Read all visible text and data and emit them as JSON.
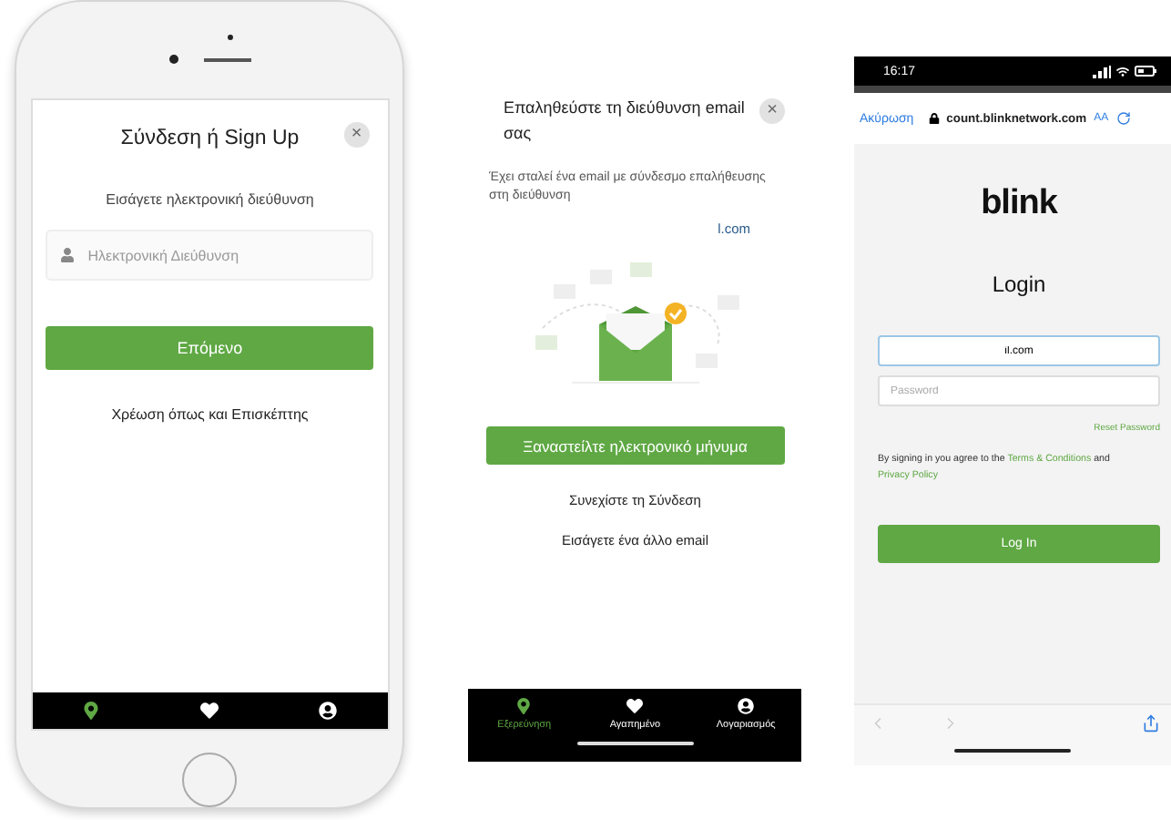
{
  "signup_screen": {
    "title": "Σύνδεση ή Sign Up",
    "close": "×",
    "prompt": "Εισάγετε ηλεκτρονική διεύθυνση",
    "email_field": {
      "placeholder": "Ηλεκτρονική Διεύθυνση"
    },
    "next_button": "Επόμενο",
    "guest_link": "Χρέωση όπως και Επισκέπτης",
    "nav_items": [
      {
        "selected": true
      },
      {
        "selected": false
      },
      {
        "selected": false
      }
    ]
  },
  "verify_screen": {
    "title": "Επαληθεύστε τη διεύθυνση email σας",
    "close": "×",
    "message": "Έχει σταλεί ένα email με σύνδεσμο επαλήθευσης στη διεύθυνση",
    "email": "l.com",
    "resend_button": "Ξαναστείλτε ηλεκτρονικό μήνυμα",
    "continue_link": "Συνεχίστε τη Σύνδεση",
    "other_email_link": "Εισάγετε ένα άλλο email",
    "nav_items": [
      {
        "label": "Εξερεύνηση",
        "selected": true
      },
      {
        "label": "Αγαπημένο",
        "selected": false
      },
      {
        "label": "Λογαριασμός",
        "selected": false
      }
    ]
  },
  "login_screen": {
    "status_time": "16:17",
    "cancel": "Ακύρωση",
    "url": "count.blinknetwork.com",
    "text_size": "AA",
    "logo": "blink",
    "title": "Login",
    "email_field": {
      "value": "il.com"
    },
    "password_field": {
      "placeholder": "Password"
    },
    "reset_link": "Reset Password",
    "terms": {
      "before": "By signing in you agree to the",
      "terms_link": "Terms & Conditions",
      "middle": "and",
      "privacy_link": "Privacy Policy"
    },
    "login_button": "Log In"
  }
}
